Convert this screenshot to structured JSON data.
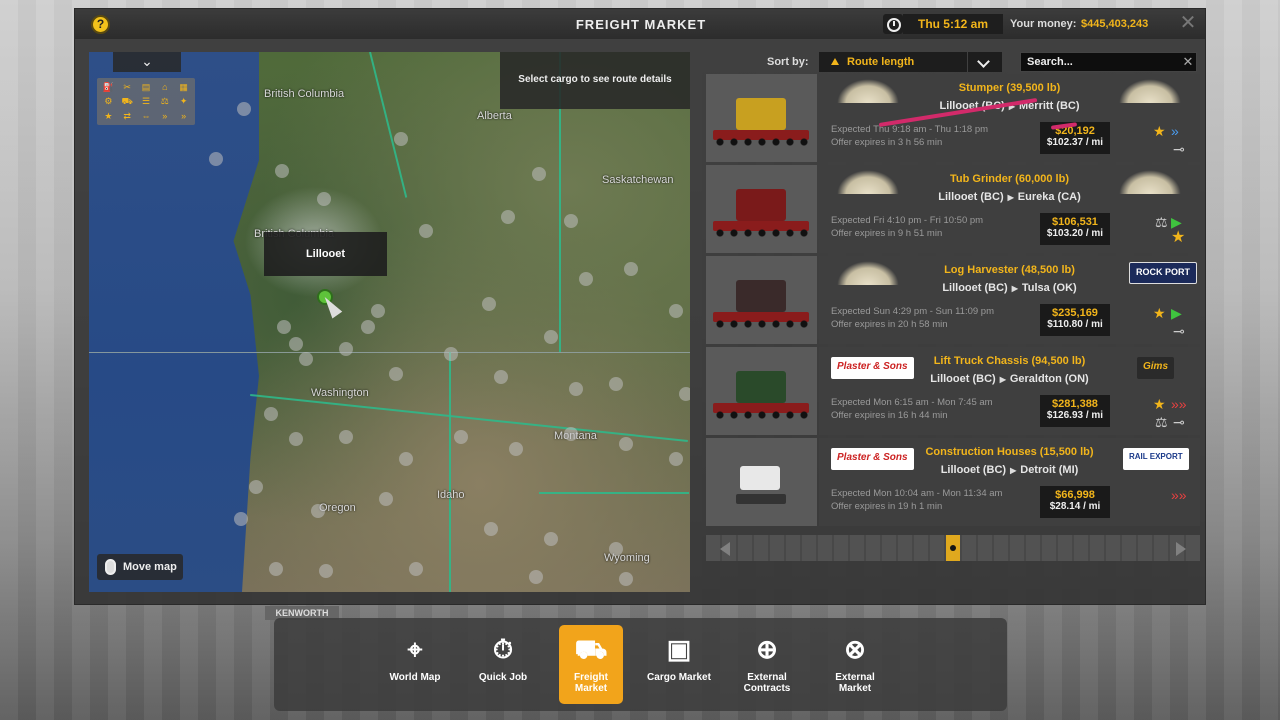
{
  "window": {
    "title": "FREIGHT MARKET",
    "help_icon": "question-icon",
    "time": "Thu 5:12 am",
    "money_label": "Your money:",
    "money_value": "$445,403,243",
    "close_icon": "close-icon"
  },
  "map": {
    "route_hint": "Select cargo to see route details",
    "selected_city": "Lillooet",
    "move_map_label": "Move map",
    "labels": [
      "British Columbia",
      "Alberta",
      "Saskatchewan",
      "British Columbia",
      "Washington",
      "Montana",
      "Oregon",
      "Idaho",
      "Wyoming"
    ]
  },
  "sort": {
    "label": "Sort by:",
    "selected": "Route length"
  },
  "search": {
    "placeholder": "Search..."
  },
  "offers": [
    {
      "cargo": "Stumper (39,500 lb)",
      "from": "Lillooet (BC)",
      "to": "Merritt (BC)",
      "expected": "Expected Thu 9:18 am - Thu 1:18 pm",
      "expires": "Offer expires in 3 h 56 min",
      "price": "$20,192",
      "per_mile": "$102.37 / mi",
      "company_logo": "sawmill-logo",
      "cargo_color": "#c8a020"
    },
    {
      "cargo": "Tub Grinder (60,000 lb)",
      "from": "Lillooet (BC)",
      "to": "Eureka (CA)",
      "expected": "Expected Fri 4:10 pm - Fri 10:50 pm",
      "expires": "Offer expires in 9 h 51 min",
      "price": "$106,531",
      "per_mile": "$103.20 / mi",
      "company_logo": "sawmill-logo",
      "cargo_color": "#7a1a1a"
    },
    {
      "cargo": "Log Harvester (48,500 lb)",
      "from": "Lillooet (BC)",
      "to": "Tulsa (OK)",
      "expected": "Expected Sun 4:29 pm - Sun 11:09 pm",
      "expires": "Offer expires in 20 h 58 min",
      "price": "$235,169",
      "per_mile": "$110.80 / mi",
      "company_logo": "sawmill-logo",
      "right_logo": "ROCK PORT",
      "cargo_color": "#3a2a2a"
    },
    {
      "cargo": "Lift Truck Chassis (94,500 lb)",
      "from": "Lillooet (BC)",
      "to": "Geraldton (ON)",
      "expected": "Expected Mon 6:15 am - Mon 7:45 am",
      "expires": "Offer expires in 16 h 44 min",
      "price": "$281,388",
      "per_mile": "$126.93 / mi",
      "left_logo": "Plaster & Sons",
      "right_logo": "Gims",
      "cargo_color": "#2a4a2a"
    },
    {
      "cargo": "Construction Houses (15,500 lb)",
      "from": "Lillooet (BC)",
      "to": "Detroit (MI)",
      "expected": "Expected Mon 10:04 am - Mon 11:34 am",
      "expires": "Offer expires in 19 h 1 min",
      "price": "$66,998",
      "per_mile": "$28.14 / mi",
      "left_logo": "Plaster & Sons",
      "right_logo": "RAIL EXPORT",
      "cargo_color": "#e8e8e8"
    }
  ],
  "dock": [
    {
      "label": "World Map",
      "icon": "map-pin-icon"
    },
    {
      "label": "Quick Job",
      "icon": "quick-job-icon"
    },
    {
      "label": "Freight Market",
      "icon": "truck-icon"
    },
    {
      "label": "Cargo Market",
      "icon": "cargo-icon"
    },
    {
      "label": "External Contracts",
      "icon": "globe-truck-icon"
    },
    {
      "label": "External Market",
      "icon": "globe-cargo-icon"
    }
  ],
  "truck_brand": "KENWORTH",
  "colors": {
    "accent": "#f2b51b",
    "active_tab": "#f2a41b",
    "annotation": "#d22a6a"
  }
}
